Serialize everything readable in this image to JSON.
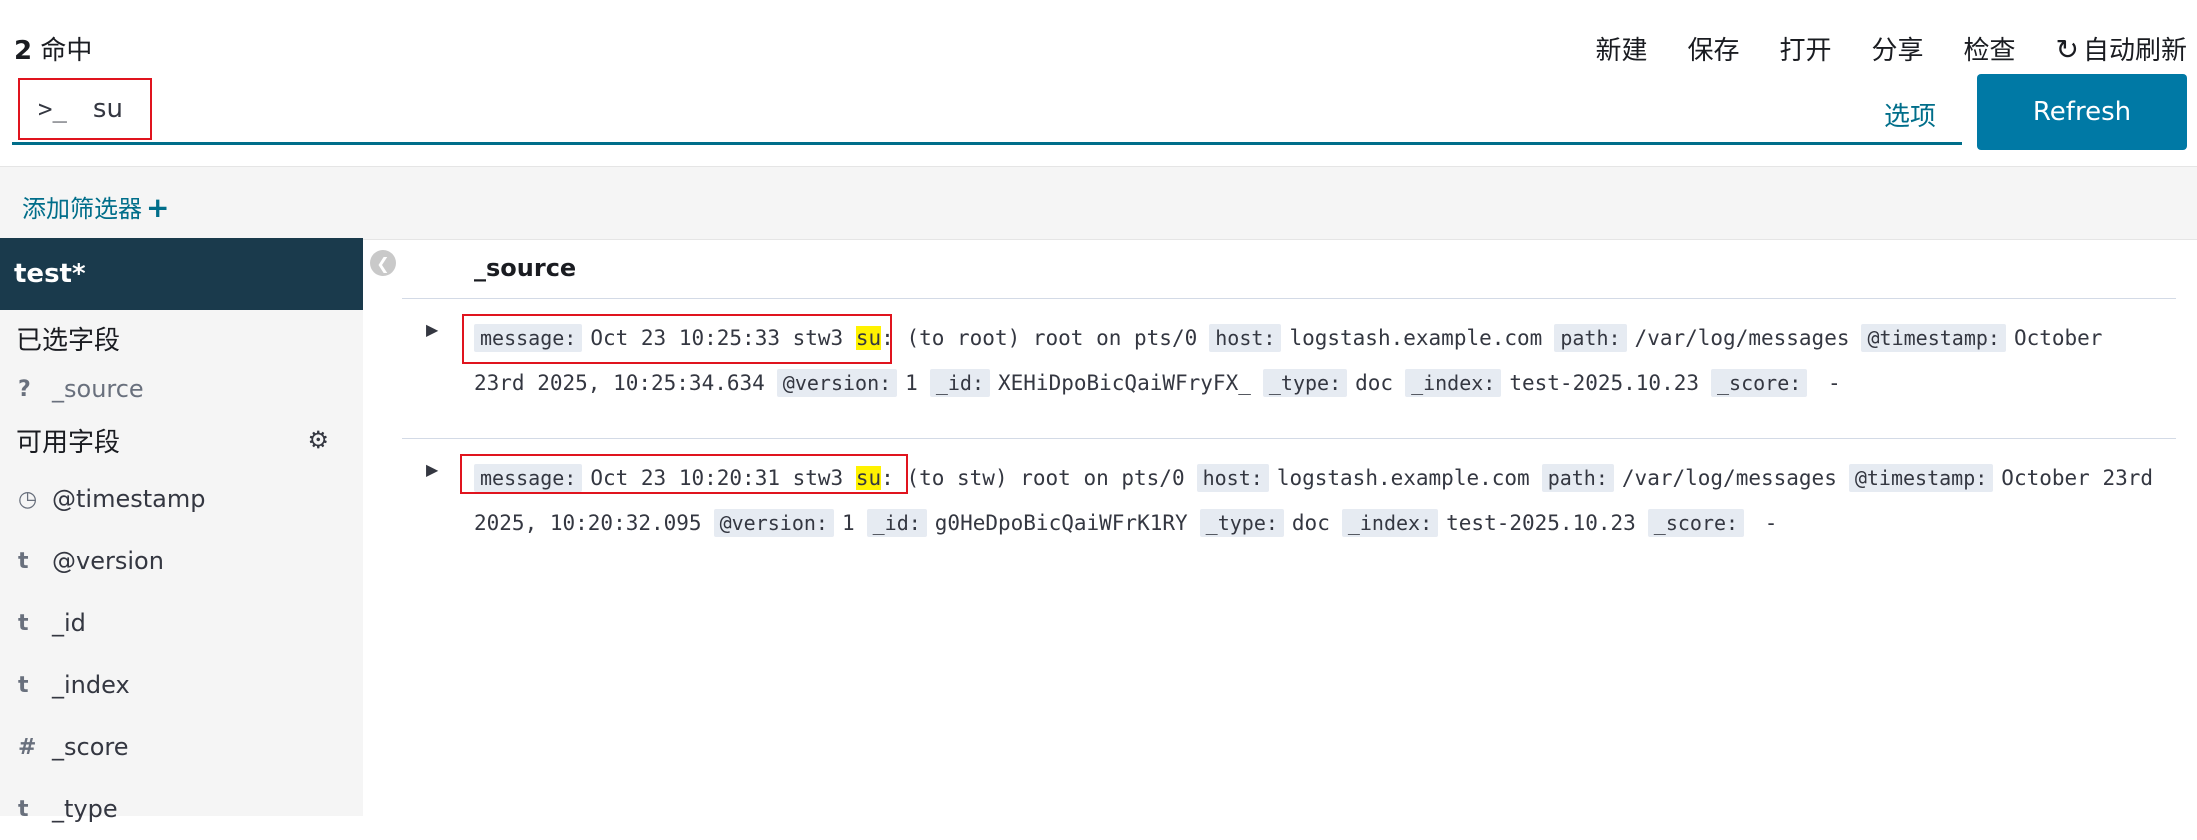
{
  "header": {
    "hits_count": "2",
    "hits_label": "命中",
    "menu": [
      "新建",
      "保存",
      "打开",
      "分享",
      "检查"
    ],
    "auto_refresh": "自动刷新"
  },
  "query": {
    "prompt": ">_",
    "value": "su",
    "options_label": "选项",
    "refresh_label": "Refresh"
  },
  "filters": {
    "add_label": "添加筛选器",
    "add_icon": "+"
  },
  "sidebar": {
    "index_pattern": "test*",
    "selected_title": "已选字段",
    "selected_fields": [
      {
        "type": "?",
        "name": "_source"
      }
    ],
    "available_title": "可用字段",
    "available_fields": [
      {
        "type": "◷",
        "name": "@timestamp"
      },
      {
        "type": "t",
        "name": "@version"
      },
      {
        "type": "t",
        "name": "_id"
      },
      {
        "type": "t",
        "name": "_index"
      },
      {
        "type": "#",
        "name": "_score"
      },
      {
        "type": "t",
        "name": "_type"
      }
    ]
  },
  "table": {
    "column": "_source",
    "rows": [
      {
        "message_key": "message:",
        "message_pre": "Oct 23 10:25:33 stw3",
        "message_hl": "su",
        "message_post": ": (to root) root on pts/0",
        "host_key": "host:",
        "host": "logstash.example.com",
        "path_key": "path:",
        "path": "/var/log/messages",
        "ts_key": "@timestamp:",
        "ts": "October 23rd 2025, 10:25:34.634",
        "version_key": "@version:",
        "version": "1",
        "id_key": "_id:",
        "id": "XEHiDpoBicQaiWFryFX_",
        "type_key": "_type:",
        "type": "doc",
        "index_key": "_index:",
        "index": "test-2025.10.23",
        "score_key": "_score:",
        "score": "-"
      },
      {
        "message_key": "message:",
        "message_pre": "Oct 23 10:20:31 stw3",
        "message_hl": "su",
        "message_post": ": (to stw) root on pts/0",
        "host_key": "host:",
        "host": "logstash.example.com",
        "path_key": "path:",
        "path": "/var/log/messages",
        "ts_key": "@timestamp:",
        "ts": "October 23rd 2025, 10:20:32.095",
        "version_key": "@version:",
        "version": "1",
        "id_key": "_id:",
        "id": "g0HeDpoBicQaiWFrK1RY",
        "type_key": "_type:",
        "type": "doc",
        "index_key": "_index:",
        "index": "test-2025.10.23",
        "score_key": "_score:",
        "score": "-"
      }
    ]
  }
}
